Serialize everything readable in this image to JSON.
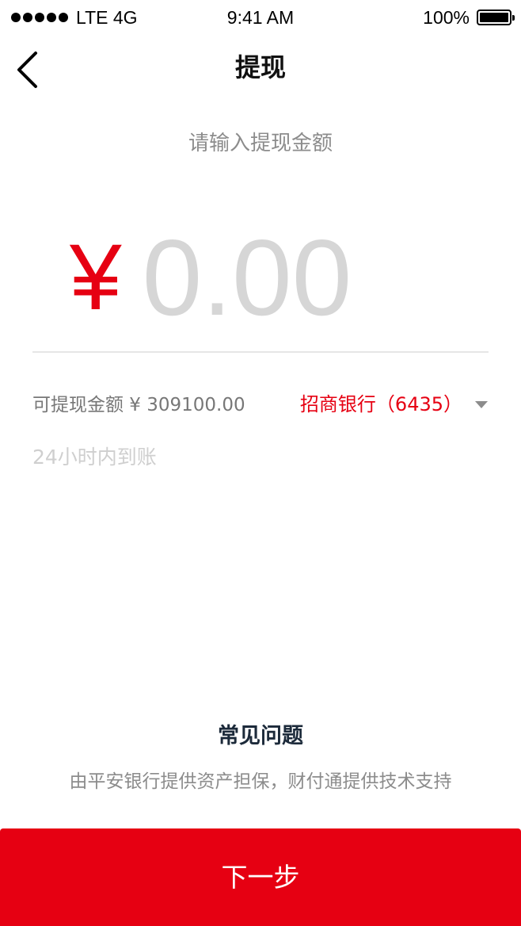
{
  "status_bar": {
    "carrier": "LTE 4G",
    "time": "9:41 AM",
    "battery_percent": "100%",
    "battery_level": 1.0
  },
  "nav": {
    "back_icon": "chevron-left-icon",
    "title": "提现"
  },
  "amount": {
    "hint": "请输入提现金额",
    "currency_symbol": "¥",
    "value": "",
    "placeholder": "0.00"
  },
  "withdraw_info": {
    "available_label": "可提现金额 ¥ 309100.00",
    "bank_label": "招商银行（6435）",
    "bank_dropdown_icon": "caret-down-icon",
    "arrival_note": "24小时内到账"
  },
  "footer": {
    "faq_link": "常见问题",
    "disclaimer": "由平安银行提供资产担保，财付通提供技术支持"
  },
  "next_button": {
    "label": "下一步"
  },
  "colors": {
    "accent_red": "#e60012",
    "placeholder_gray": "#d6d6d6",
    "hint_gray": "#8c8c8c",
    "faq_text": "#1c2a3a"
  }
}
